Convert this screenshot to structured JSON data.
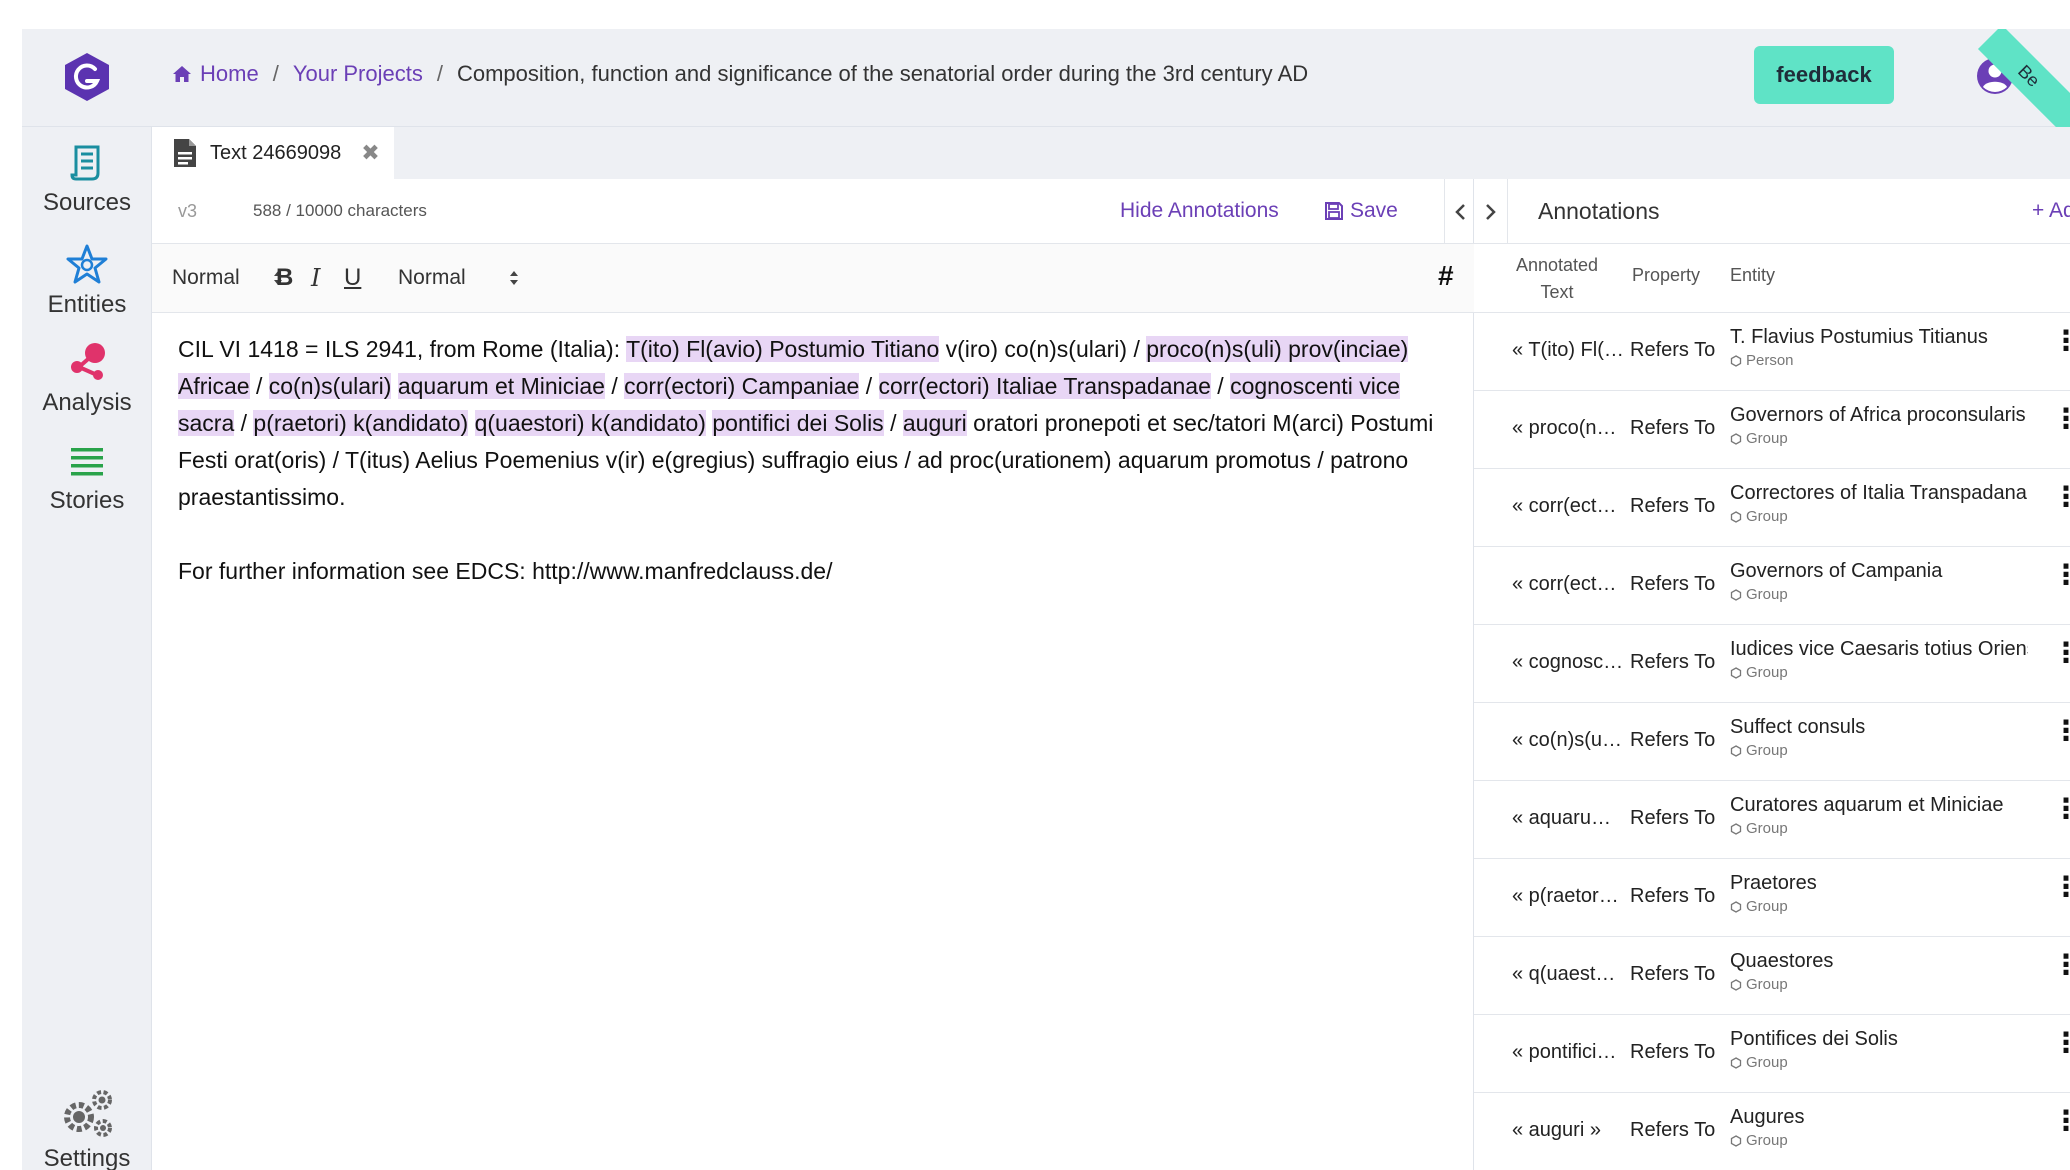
{
  "header": {
    "breadcrumb": {
      "home": "Home",
      "projects": "Your Projects",
      "current": "Composition, function and significance of the senatorial order during the 3rd century AD"
    },
    "feedback_label": "feedback",
    "beta_label": "Be"
  },
  "sidebar": {
    "items": [
      {
        "label": "Sources",
        "icon": "scroll-icon"
      },
      {
        "label": "Entities",
        "icon": "star-icon"
      },
      {
        "label": "Analysis",
        "icon": "network-icon"
      },
      {
        "label": "Stories",
        "icon": "lines-icon"
      },
      {
        "label": "Settings",
        "icon": "gears-icon"
      }
    ]
  },
  "tab": {
    "label": "Text 24669098",
    "close": "✖"
  },
  "editor": {
    "version": "v3",
    "char_count": "588 / 10000 characters",
    "hide_annotations": "Hide Annotations",
    "save": "Save",
    "toolbar": {
      "heading_select": "Normal",
      "size_select": "Normal",
      "bold": "B",
      "italic": "I",
      "underline": "U",
      "hash": "#"
    },
    "content": {
      "p1": [
        "CIL VI 1418 = ILS 2941, from Rome (Italia): ",
        "T(ito) Fl(avio) Postumio Titiano",
        " v(iro) co(n)s(ulari) / ",
        "proco(n)s(uli) prov(inciae) Africae",
        " / ",
        "co(n)s(ulari)",
        " ",
        "aquarum et Miniciae",
        " / ",
        "corr(ectori) Campaniae",
        " / ",
        "corr(ectori) Italiae Transpadanae",
        " / ",
        "cognoscenti vice sacra",
        " / ",
        "p(raetori) k(andidato)",
        " ",
        "q(uaestori) k(andidato)",
        " ",
        "pontifici dei Solis",
        " / ",
        "auguri",
        " oratori pronepoti et sec/tatori M(arci) Postumi Festi orat(oris) / T(itus) Aelius Poemenius v(ir) e(gregius) suffragio eius / ad proc(urationem) aquarum promotus / patrono praestantissimo."
      ],
      "p2": "For further information see EDCS: http://www.manfredclauss.de/"
    }
  },
  "annotations": {
    "title": "Annotations",
    "add": "+ Add",
    "columns": {
      "text": "Annotated Text",
      "property": "Property",
      "entity": "Entity"
    },
    "rows": [
      {
        "text": "« T(ito) Fl(…",
        "property": "Refers To",
        "entity": "T. Flavius Postumius Titianus",
        "type": "Person"
      },
      {
        "text": "« proco(n…",
        "property": "Refers To",
        "entity": "Governors of Africa proconsularis",
        "type": "Group"
      },
      {
        "text": "« corr(ect…",
        "property": "Refers To",
        "entity": "Correctores of Italia Transpadana",
        "type": "Group"
      },
      {
        "text": "« corr(ect…",
        "property": "Refers To",
        "entity": "Governors of Campania",
        "type": "Group"
      },
      {
        "text": "« cognosc…",
        "property": "Refers To",
        "entity": "Iudices vice Caesaris totius Oriens",
        "type": "Group"
      },
      {
        "text": "« co(n)s(u…",
        "property": "Refers To",
        "entity": "Suffect consuls",
        "type": "Group"
      },
      {
        "text": "« aquaru…",
        "property": "Refers To",
        "entity": "Curatores aquarum et Miniciae",
        "type": "Group"
      },
      {
        "text": "« p(raetor…",
        "property": "Refers To",
        "entity": "Praetores",
        "type": "Group"
      },
      {
        "text": "« q(uaest…",
        "property": "Refers To",
        "entity": "Quaestores",
        "type": "Group"
      },
      {
        "text": "« pontifici…",
        "property": "Refers To",
        "entity": "Pontifices dei Solis",
        "type": "Group"
      },
      {
        "text": "« auguri »",
        "property": "Refers To",
        "entity": "Augures",
        "type": "Group"
      }
    ]
  },
  "colors": {
    "accent": "#6b3fb6",
    "feedback": "#5fe3c6",
    "highlight": "#e8d6f5"
  }
}
